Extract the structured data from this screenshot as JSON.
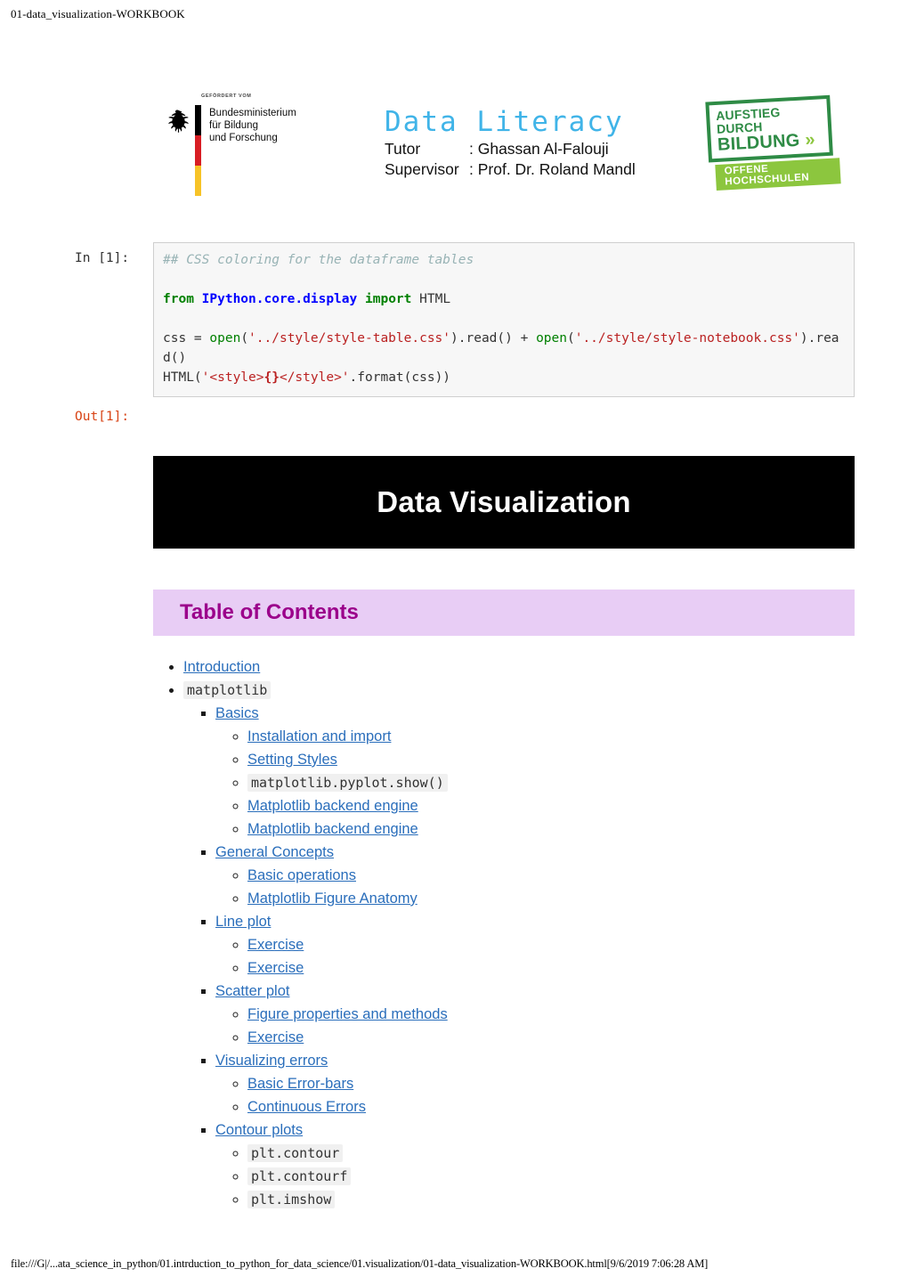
{
  "page": {
    "header_title": "01-data_visualization-WORKBOOK",
    "footer_path": "file:///G|/...ata_science_in_python/01.intrduction_to_python_for_data_science/01.visualization/01-data_visualization-WORKBOOK.html[9/6/2019 7:06:28 AM]"
  },
  "banner": {
    "bmbf": {
      "kicker": "GEFÖRDERT VOM",
      "line1": "Bundesministerium",
      "line2": "für Bildung",
      "line3": "und Forschung"
    },
    "literacy": {
      "title": "Data Literacy",
      "tutor_label": "Tutor",
      "tutor_value": ": Ghassan Al-Falouji",
      "supervisor_label": "Supervisor",
      "supervisor_value": ": Prof. Dr. Roland Mandl"
    },
    "aufstieg": {
      "line1": "AUFSTIEG DURCH",
      "line2": "BILDUNG",
      "chevron": "»",
      "strip": "OFFENE HOCHSCHULEN"
    }
  },
  "cell": {
    "in_prompt": "In [1]:",
    "out_prompt": "Out[1]:",
    "code": {
      "comment": "## CSS coloring for the dataframe tables",
      "kw_from": "from",
      "module": "IPython.core.display",
      "kw_import": "import",
      "imported": "HTML",
      "line3_a": "css = ",
      "line3_open1": "open",
      "line3_p1": "(",
      "line3_str1": "'../style/style-table.css'",
      "line3_b": ").read() + ",
      "line3_open2": "open",
      "line3_p2": "(",
      "line3_str2": "'../style/style-notebook.css'",
      "line3_c": ").read()",
      "line4_a": "HTML(",
      "line4_str_open": "'<style>",
      "line4_braces": "{}",
      "line4_str_close": "</style>'",
      "line4_b": ".format(css))"
    }
  },
  "output": {
    "title_banner": "Data Visualization",
    "toc_heading": "Table of Contents",
    "toc": [
      {
        "type": "link",
        "label": "Introduction",
        "level": 1
      },
      {
        "type": "code",
        "label": "matplotlib",
        "level": 1
      },
      {
        "type": "link",
        "label": "Basics",
        "level": 2
      },
      {
        "type": "link",
        "label": "Installation and import",
        "level": 3
      },
      {
        "type": "link",
        "label": "Setting Styles",
        "level": 3
      },
      {
        "type": "code",
        "label": "matplotlib.pyplot.show()",
        "level": 3
      },
      {
        "type": "link",
        "label": "Matplotlib backend engine",
        "level": 3
      },
      {
        "type": "link",
        "label": "Matplotlib backend engine",
        "level": 3
      },
      {
        "type": "link",
        "label": "General Concepts",
        "level": 2
      },
      {
        "type": "link",
        "label": "Basic operations",
        "level": 3
      },
      {
        "type": "link",
        "label": "Matplotlib Figure Anatomy",
        "level": 3
      },
      {
        "type": "link",
        "label": "Line plot",
        "level": 2
      },
      {
        "type": "link",
        "label": "Exercise",
        "level": 3
      },
      {
        "type": "link",
        "label": "Exercise",
        "level": 3
      },
      {
        "type": "link",
        "label": "Scatter plot",
        "level": 2
      },
      {
        "type": "link",
        "label": "Figure properties and methods",
        "level": 3
      },
      {
        "type": "link",
        "label": "Exercise",
        "level": 3
      },
      {
        "type": "link",
        "label": "Visualizing errors",
        "level": 2
      },
      {
        "type": "link",
        "label": "Basic Error-bars",
        "level": 3
      },
      {
        "type": "link",
        "label": "Continuous Errors",
        "level": 3
      },
      {
        "type": "link",
        "label": "Contour plots",
        "level": 2
      },
      {
        "type": "code",
        "label": "plt.contour",
        "level": 3
      },
      {
        "type": "code",
        "label": "plt.contourf",
        "level": 3
      },
      {
        "type": "code",
        "label": "plt.imshow",
        "level": 3
      }
    ]
  },
  "colors": {
    "link": "#2a6ebb",
    "toc_header_bg": "#e8cdf5",
    "toc_header_fg": "#9b008b",
    "banner_bg": "#000000",
    "banner_fg": "#ffffff",
    "out_prompt": "#d84315",
    "literacy_blue": "#40b4e8",
    "green": "#2e8b45",
    "light_green": "#8cc63e"
  }
}
